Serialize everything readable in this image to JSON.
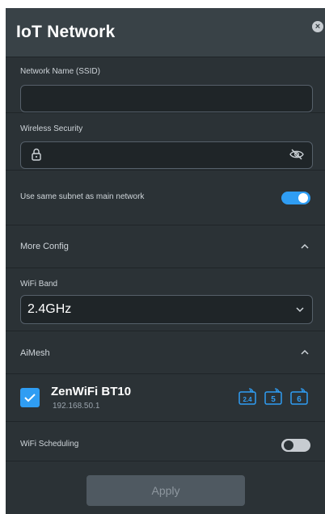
{
  "dialog": {
    "title": "IoT Network",
    "close_icon": "close-icon"
  },
  "ssid": {
    "label": "Network Name (SSID)",
    "value": "",
    "placeholder": ""
  },
  "security": {
    "label": "Wireless Security",
    "value": "",
    "lock_icon": "lock-icon",
    "visibility_icon": "eye-off-icon"
  },
  "subnet": {
    "label": "Use same subnet as main network",
    "enabled": true
  },
  "more_config": {
    "label": "More Config",
    "expanded": true
  },
  "wifi_band": {
    "label": "WiFi Band",
    "selected": "2.4GHz"
  },
  "aimesh": {
    "label": "AiMesh",
    "expanded": true,
    "devices": [
      {
        "name": "ZenWiFi BT10",
        "ip": "192.168.50.1",
        "checked": true,
        "bands": [
          "2.4",
          "5",
          "6"
        ]
      }
    ]
  },
  "scheduling": {
    "label": "WiFi Scheduling",
    "enabled": false
  },
  "actions": {
    "apply_label": "Apply"
  },
  "colors": {
    "accent": "#2f9df3",
    "panel_bg": "#2b3236",
    "header_bg": "#394247"
  }
}
